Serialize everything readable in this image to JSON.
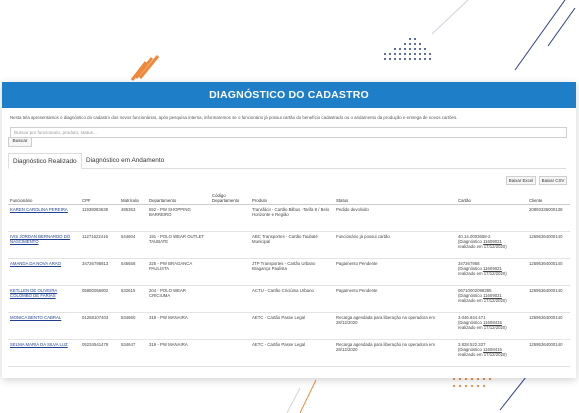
{
  "header": {
    "title": "DIAGNÓSTICO DO CADASTRO"
  },
  "intro": "Nesta tela apresentamos o diagnóstico do cadastro dos novos funcionários, após pesquisa interna, informaremos se o funcionário já possui cartão do benefício cadastrado ou o andamento da produção e entrega de novos cartões.",
  "search": {
    "placeholder": "Buscar por funcionario, produto, status...",
    "button": "Buscar"
  },
  "tabs": [
    {
      "label": "Diagnóstico Realizado",
      "active": true
    },
    {
      "label": "Diagnóstico em Andamento",
      "active": false
    }
  ],
  "export": {
    "excel": "Baixar Excel",
    "csv": "Baixar CSV"
  },
  "table": {
    "columns": [
      "Funcionário",
      "CPF",
      "Matrícula",
      "Departamento",
      "Código Departamento",
      "Produto",
      "Status",
      "Cartão",
      "Cliente"
    ],
    "rows": [
      {
        "funcionario": "KAREN CAROLINA PEREIRA",
        "cpf": "11938083639",
        "matricula": "485353",
        "departamento": "552 - PW SHOPPING BARREIRO",
        "codigo": "",
        "produto": "TransfáciI - Cartão Bilbus -Tarifa 8 / Belo Horizonte e Região",
        "status": "Pedido devolvido",
        "cartao_num": "",
        "cartao_diag": "",
        "cartao_date": "",
        "cliente": "20893336000138"
      },
      {
        "funcionario": "IVIS JORDAN BERNARDO DO NASCIMENTO",
        "cpf": "11271622416",
        "matricula": "544604",
        "departamento": "191 - POLO WEAR OUTLET TAUBATE",
        "codigo": "",
        "produto": "ABC Transportes - Cartão Taubaté Municipal",
        "status": "Funcionário já possui cartão",
        "cartao_num": "40.14.0003658-2",
        "cartao_diag": "11609021",
        "cartao_date": "realizado em 17/12/2020)",
        "cliente": "12595364000140"
      },
      {
        "funcionario": "AMANDA DA NOVA ARAO",
        "cpf": "34726795813",
        "matricula": "545658",
        "departamento": "325 - PW BRAGANCA PAULISTA",
        "codigo": "",
        "produto": "JTP Transportes - Cartão Urbano Bragança Paulista",
        "status": "Pagamento Pendente",
        "cartao_num": "347267958",
        "cartao_diag": "11609021",
        "cartao_date": "realizado em 17/12/2020)",
        "cliente": "12595364000140"
      },
      {
        "funcionario": "KETLLEN DE OLIVEIRA COLOMBO DE FARIAS",
        "cpf": "05880056902",
        "matricula": "532615",
        "departamento": "204 - POLO WEAR CRICIUMA",
        "codigo": "",
        "produto": "ACTU - Cartão Criciúma Urbano",
        "status": "Pagamento Pendente",
        "cartao_num": "06710002098395",
        "cartao_diag": "11609021",
        "cartao_date": "realizado em 17/12/2020)",
        "cliente": "12595364000140"
      },
      {
        "funcionario": "MONICA BENTO CABRAL",
        "cpf": "01268107403",
        "matricula": "534660",
        "departamento": "319 - PW MANAIRA",
        "codigo": "",
        "produto": "AETC - Cartão Passe Legal",
        "status": "Recarga agendada para liberação na operadora em 28/12/2020",
        "cartao_num": "3.046.844.471",
        "cartao_diag": "11608415",
        "cartao_date": "realizado em 17/12/2020)",
        "cliente": "12595364000140"
      },
      {
        "funcionario": "SELMA MARIA DA SILVA LUZ",
        "cpf": "05234541479",
        "matricula": "534647",
        "departamento": "319 - PW MANAIRA",
        "codigo": "",
        "produto": "AETC - Cartão Passe Legal",
        "status": "Recarga agendada para liberação na operadora em 28/12/2020",
        "cartao_num": "3.828.522.327",
        "cartao_diag": "11608415",
        "cartao_date": "realizado em 17/12/2020)",
        "cliente": "12595364000140"
      }
    ],
    "diag_prefix": "(Diagnóstico "
  },
  "colors": {
    "header": "#1e7ec8",
    "deco_orange": "#f0883c",
    "deco_navy": "#2c3e86"
  }
}
